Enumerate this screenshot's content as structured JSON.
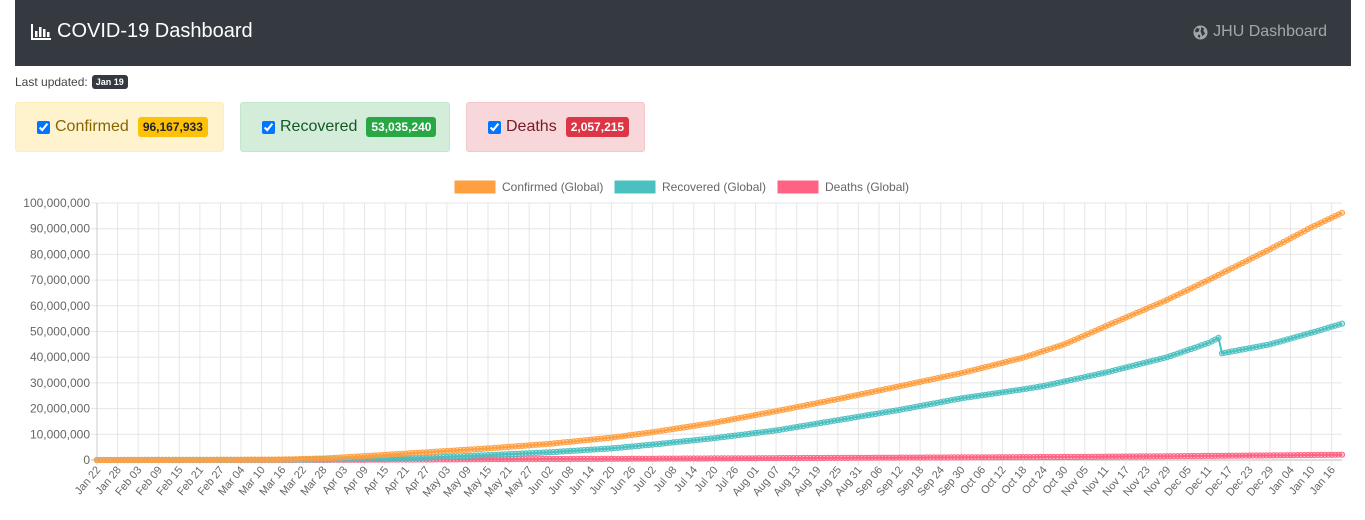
{
  "navbar": {
    "title": "COVID-19 Dashboard",
    "jhu_label": "JHU Dashboard"
  },
  "status": {
    "updated_label": "Last updated:",
    "updated_date": "Jan 19"
  },
  "cards": {
    "confirmed": {
      "label": "Confirmed",
      "count": "96,167,933",
      "checked": true
    },
    "recovered": {
      "label": "Recovered",
      "count": "53,035,240",
      "checked": true
    },
    "deaths": {
      "label": "Deaths",
      "count": "2,057,215",
      "checked": true
    }
  },
  "chart_data": {
    "type": "line",
    "title": "",
    "xlabel": "",
    "ylabel": "",
    "ylim": [
      0,
      100000000
    ],
    "y_ticks": [
      0,
      10000000,
      20000000,
      30000000,
      40000000,
      50000000,
      60000000,
      70000000,
      80000000,
      90000000,
      100000000
    ],
    "x_tick_labels": [
      "Jan 22",
      "Jan 28",
      "Feb 03",
      "Feb 09",
      "Feb 15",
      "Feb 21",
      "Feb 27",
      "Mar 04",
      "Mar 10",
      "Mar 16",
      "Mar 22",
      "Mar 28",
      "Apr 03",
      "Apr 09",
      "Apr 15",
      "Apr 21",
      "Apr 27",
      "May 03",
      "May 09",
      "May 15",
      "May 21",
      "May 27",
      "Jun 02",
      "Jun 08",
      "Jun 14",
      "Jun 20",
      "Jun 26",
      "Jul 02",
      "Jul 08",
      "Jul 14",
      "Jul 20",
      "Jul 26",
      "Aug 01",
      "Aug 07",
      "Aug 13",
      "Aug 19",
      "Aug 25",
      "Aug 31",
      "Sep 06",
      "Sep 12",
      "Sep 18",
      "Sep 24",
      "Sep 30",
      "Oct 06",
      "Oct 12",
      "Oct 18",
      "Oct 24",
      "Oct 30",
      "Nov 05",
      "Nov 11",
      "Nov 17",
      "Nov 23",
      "Nov 29",
      "Dec 05",
      "Dec 11",
      "Dec 17",
      "Dec 23",
      "Dec 29",
      "Jan 04",
      "Jan 10",
      "Jan 16"
    ],
    "x_interval_days": 6,
    "grid": true,
    "legend_position": "top",
    "series": [
      {
        "name": "Confirmed (Global)",
        "color": "#ff9f40",
        "points": [
          [
            "Jan 22",
            0
          ],
          [
            "Feb 21",
            80000
          ],
          [
            "Mar 16",
            180000
          ],
          [
            "Mar 28",
            600000
          ],
          [
            "Apr 09",
            1500000
          ],
          [
            "Apr 27",
            3000000
          ],
          [
            "May 15",
            4500000
          ],
          [
            "Jun 02",
            6300000
          ],
          [
            "Jun 20",
            8700000
          ],
          [
            "Jul 02",
            10800000
          ],
          [
            "Jul 20",
            14500000
          ],
          [
            "Aug 07",
            19000000
          ],
          [
            "Aug 25",
            23700000
          ],
          [
            "Sep 12",
            28700000
          ],
          [
            "Sep 30",
            33800000
          ],
          [
            "Oct 18",
            39800000
          ],
          [
            "Oct 30",
            45000000
          ],
          [
            "Nov 11",
            52000000
          ],
          [
            "Nov 29",
            62300000
          ],
          [
            "Dec 11",
            70000000
          ],
          [
            "Dec 17",
            74000000
          ],
          [
            "Dec 29",
            82000000
          ],
          [
            "Jan 10",
            90500000
          ],
          [
            "Jan 19",
            96167933
          ]
        ]
      },
      {
        "name": "Recovered (Global)",
        "color": "#4bc0c0",
        "points": [
          [
            "Jan 22",
            0
          ],
          [
            "Mar 16",
            80000
          ],
          [
            "Apr 03",
            300000
          ],
          [
            "Apr 27",
            900000
          ],
          [
            "May 15",
            1900000
          ],
          [
            "Jun 02",
            3000000
          ],
          [
            "Jun 20",
            4500000
          ],
          [
            "Jul 02",
            6000000
          ],
          [
            "Jul 20",
            8500000
          ],
          [
            "Aug 07",
            11500000
          ],
          [
            "Aug 25",
            15500000
          ],
          [
            "Sep 12",
            19500000
          ],
          [
            "Sep 30",
            24000000
          ],
          [
            "Oct 18",
            27500000
          ],
          [
            "Oct 24",
            28800000
          ],
          [
            "Nov 11",
            34000000
          ],
          [
            "Nov 29",
            40000000
          ],
          [
            "Dec 11",
            45500000
          ],
          [
            "Dec 14",
            47500000
          ],
          [
            "Dec 15",
            41500000
          ],
          [
            "Dec 29",
            45000000
          ],
          [
            "Jan 10",
            49500000
          ],
          [
            "Jan 19",
            53035240
          ]
        ]
      },
      {
        "name": "Deaths (Global)",
        "color": "#ff6384",
        "points": [
          [
            "Jan 22",
            0
          ],
          [
            "Mar 16",
            7000
          ],
          [
            "Apr 09",
            95000
          ],
          [
            "May 15",
            300000
          ],
          [
            "Jun 20",
            460000
          ],
          [
            "Jul 20",
            610000
          ],
          [
            "Aug 25",
            820000
          ],
          [
            "Sep 30",
            1010000
          ],
          [
            "Oct 30",
            1190000
          ],
          [
            "Nov 29",
            1460000
          ],
          [
            "Dec 29",
            1790000
          ],
          [
            "Jan 19",
            2057215
          ]
        ]
      }
    ]
  }
}
